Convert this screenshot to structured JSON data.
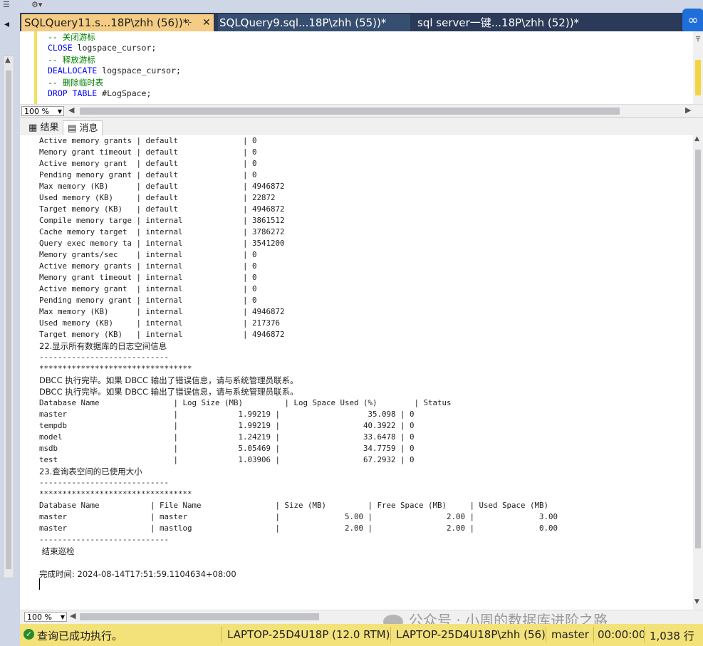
{
  "toolbar_strip": {
    "icons": [
      "align-icon",
      "dropdown-icon"
    ]
  },
  "tabs": [
    {
      "label": "SQLQuery11.s...18P\\zhh (56))*",
      "pin": "⊹",
      "close": "✕",
      "active": true
    },
    {
      "label": "SQLQuery9.sql...18P\\zhh (55))*",
      "active": false
    },
    {
      "label": "sql server一键...18P\\zhh (52))*",
      "active": false
    }
  ],
  "editor": {
    "lines": [
      {
        "cls": "cm",
        "text": "-- 关闭游标"
      },
      {
        "cls": "kw",
        "text": "CLOSE",
        "rest": " logspace_cursor;"
      },
      {
        "cls": "cm",
        "text": "-- 释放游标"
      },
      {
        "cls": "kw",
        "text": "DEALLOCATE",
        "rest": " logspace_cursor;"
      },
      {
        "cls": "cm",
        "text": "-- 删除临时表"
      },
      {
        "cls": "kw",
        "text": "DROP TABLE",
        "rest": " #LogSpace;"
      }
    ],
    "zoom": "100 %"
  },
  "result_tabs": {
    "results": "结果",
    "messages": "消息"
  },
  "messages": [
    "Active memory grants | default              | 0",
    "Memory grant timeout | default              | 0",
    "Active memory grant  | default              | 0",
    "Pending memory grant | default              | 0",
    "Max memory (KB)      | default              | 4946872",
    "Used memory (KB)     | default              | 22872",
    "Target memory (KB)   | default              | 4946872",
    "Compile memory targe | internal             | 3861512",
    "Cache memory target  | internal             | 3786272",
    "Query exec memory ta | internal             | 3541200",
    "Memory grants/sec    | internal             | 0",
    "Active memory grants | internal             | 0",
    "Memory grant timeout | internal             | 0",
    "Active memory grant  | internal             | 0",
    "Pending memory grant | internal             | 0",
    "Max memory (KB)      | internal             | 4946872",
    "Used memory (KB)     | internal             | 217376",
    "Target memory (KB)   | internal             | 4946872",
    "22.显示所有数据库的日志空间信息",
    "----------------------------",
    "*********************************",
    "DBCC 执行完毕。如果 DBCC 输出了错误信息，请与系统管理员联系。",
    "DBCC 执行完毕。如果 DBCC 输出了错误信息，请与系统管理员联系。",
    "Database Name                | Log Size (MB)         | Log Space Used (%)        | Status",
    "master                       |             1.99219 |                   35.098 | 0",
    "tempdb                       |             1.99219 |                  40.3922 | 0",
    "model                        |             1.24219 |                  33.6478 | 0",
    "msdb                         |             5.05469 |                  34.7759 | 0",
    "test                         |             1.03906 |                  67.2932 | 0",
    "23.查询表空间的已使用大小",
    "----------------------------",
    "*********************************",
    "Database Name           | File Name                | Size (MB)         | Free Space (MB)     | Used Space (MB)",
    "master                  | master                   |              5.00 |                2.00 |              3.00",
    "master                  | mastlog                  |              2.00 |                2.00 |              0.00",
    "----------------------------",
    " 结束巡检",
    "",
    "完成时间: 2024-08-14T17:51:59.1104634+08:00"
  ],
  "results_zoom": "100 %",
  "watermark": "公众号 · 小周的数据库进阶之路",
  "status": {
    "message": "查询已成功执行。",
    "server": "LAPTOP-25D4U18P (12.0 RTM)",
    "login": "LAPTOP-25D4U18P\\zhh (56)",
    "database": "master",
    "elapsed": "00:00:00",
    "rows": "1,038 行"
  },
  "colors": {
    "status_bar": "#f3e27a",
    "active_tab": "#f5cc84",
    "frame": "#2b3a58",
    "comment": "#008000",
    "keyword": "#0000ff"
  }
}
